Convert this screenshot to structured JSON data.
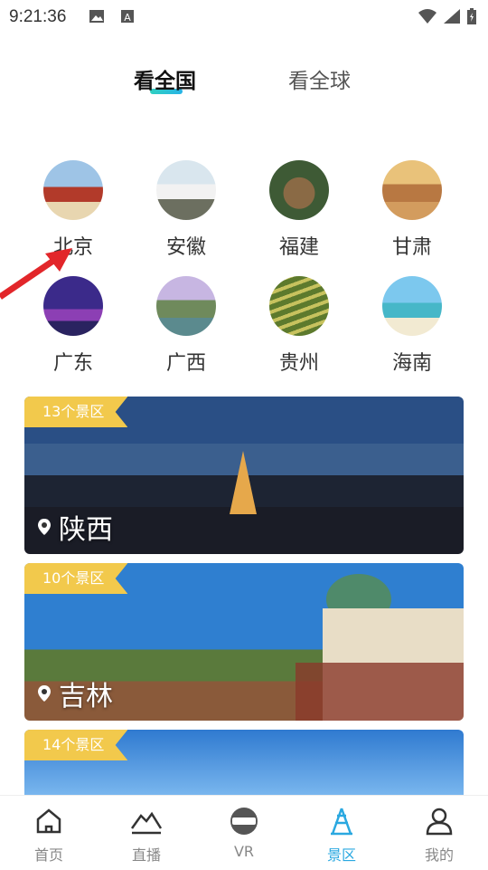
{
  "status": {
    "time": "9:21:36"
  },
  "tabs": {
    "active": "看全国",
    "inactive": "看全球"
  },
  "provinces": [
    {
      "name": "北京"
    },
    {
      "name": "安徽"
    },
    {
      "name": "福建"
    },
    {
      "name": "甘肃"
    },
    {
      "name": "广东"
    },
    {
      "name": "广西"
    },
    {
      "name": "贵州"
    },
    {
      "name": "海南"
    }
  ],
  "cards": [
    {
      "badge": "13个景区",
      "title": "陕西"
    },
    {
      "badge": "10个景区",
      "title": "吉林"
    },
    {
      "badge": "14个景区",
      "title": ""
    }
  ],
  "nav": [
    {
      "label": "首页",
      "icon": "home-icon"
    },
    {
      "label": "直播",
      "icon": "live-icon"
    },
    {
      "label": "VR",
      "icon": "vr-icon"
    },
    {
      "label": "景区",
      "icon": "scenic-tower-icon",
      "active": true
    },
    {
      "label": "我的",
      "icon": "profile-icon"
    }
  ],
  "colors": {
    "accent": "#2aa8e0",
    "badge": "#f2c94c",
    "underline": "#2fd0c0"
  }
}
